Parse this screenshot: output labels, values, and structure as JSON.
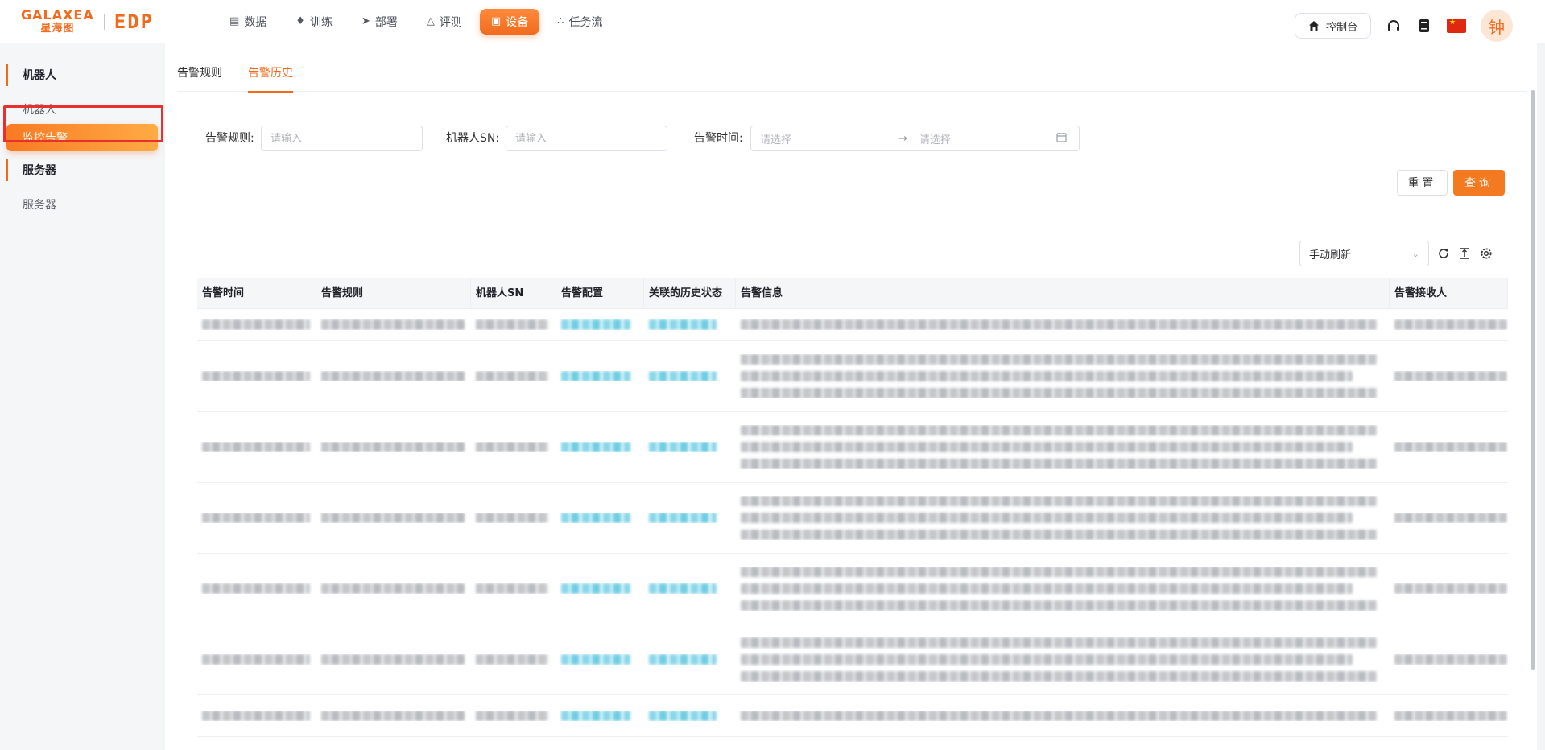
{
  "header": {
    "logo_en": "GALAXEA",
    "logo_cn": "星海图",
    "logo_product": "EDP",
    "nav": [
      {
        "label": "数据",
        "icon": "database-icon",
        "active": false
      },
      {
        "label": "训练",
        "icon": "flame-icon",
        "active": false
      },
      {
        "label": "部署",
        "icon": "rocket-icon",
        "active": false
      },
      {
        "label": "评测",
        "icon": "flask-icon",
        "active": false
      },
      {
        "label": "设备",
        "icon": "robot-icon",
        "active": true
      },
      {
        "label": "任务流",
        "icon": "workflow-icon",
        "active": false
      }
    ],
    "console_label": "控制台",
    "avatar_text": "钟"
  },
  "sidebar": {
    "groups": [
      {
        "title": "机器人",
        "items": [
          {
            "label": "机器人",
            "active": false
          },
          {
            "label": "监控告警",
            "active": true
          }
        ]
      },
      {
        "title": "服务器",
        "items": [
          {
            "label": "服务器",
            "active": false
          }
        ]
      }
    ]
  },
  "tabs": [
    {
      "label": "告警规则",
      "active": false
    },
    {
      "label": "告警历史",
      "active": true
    }
  ],
  "filters": {
    "rule_label": "告警规则:",
    "rule_placeholder": "请输入",
    "sn_label": "机器人SN:",
    "sn_placeholder": "请输入",
    "time_label": "告警时间:",
    "time_start_placeholder": "请选择",
    "time_end_placeholder": "请选择"
  },
  "actions": {
    "reset_label": "重置",
    "query_label": "查询",
    "refresh_mode": "手动刷新"
  },
  "table": {
    "columns": [
      "告警时间",
      "告警规则",
      "机器人SN",
      "告警配置",
      "关联的历史状态",
      "告警信息",
      "告警接收人"
    ],
    "rows_note_redacted": true
  },
  "colors": {
    "brand": "#f26b1d",
    "highlight": "#e8302f"
  }
}
